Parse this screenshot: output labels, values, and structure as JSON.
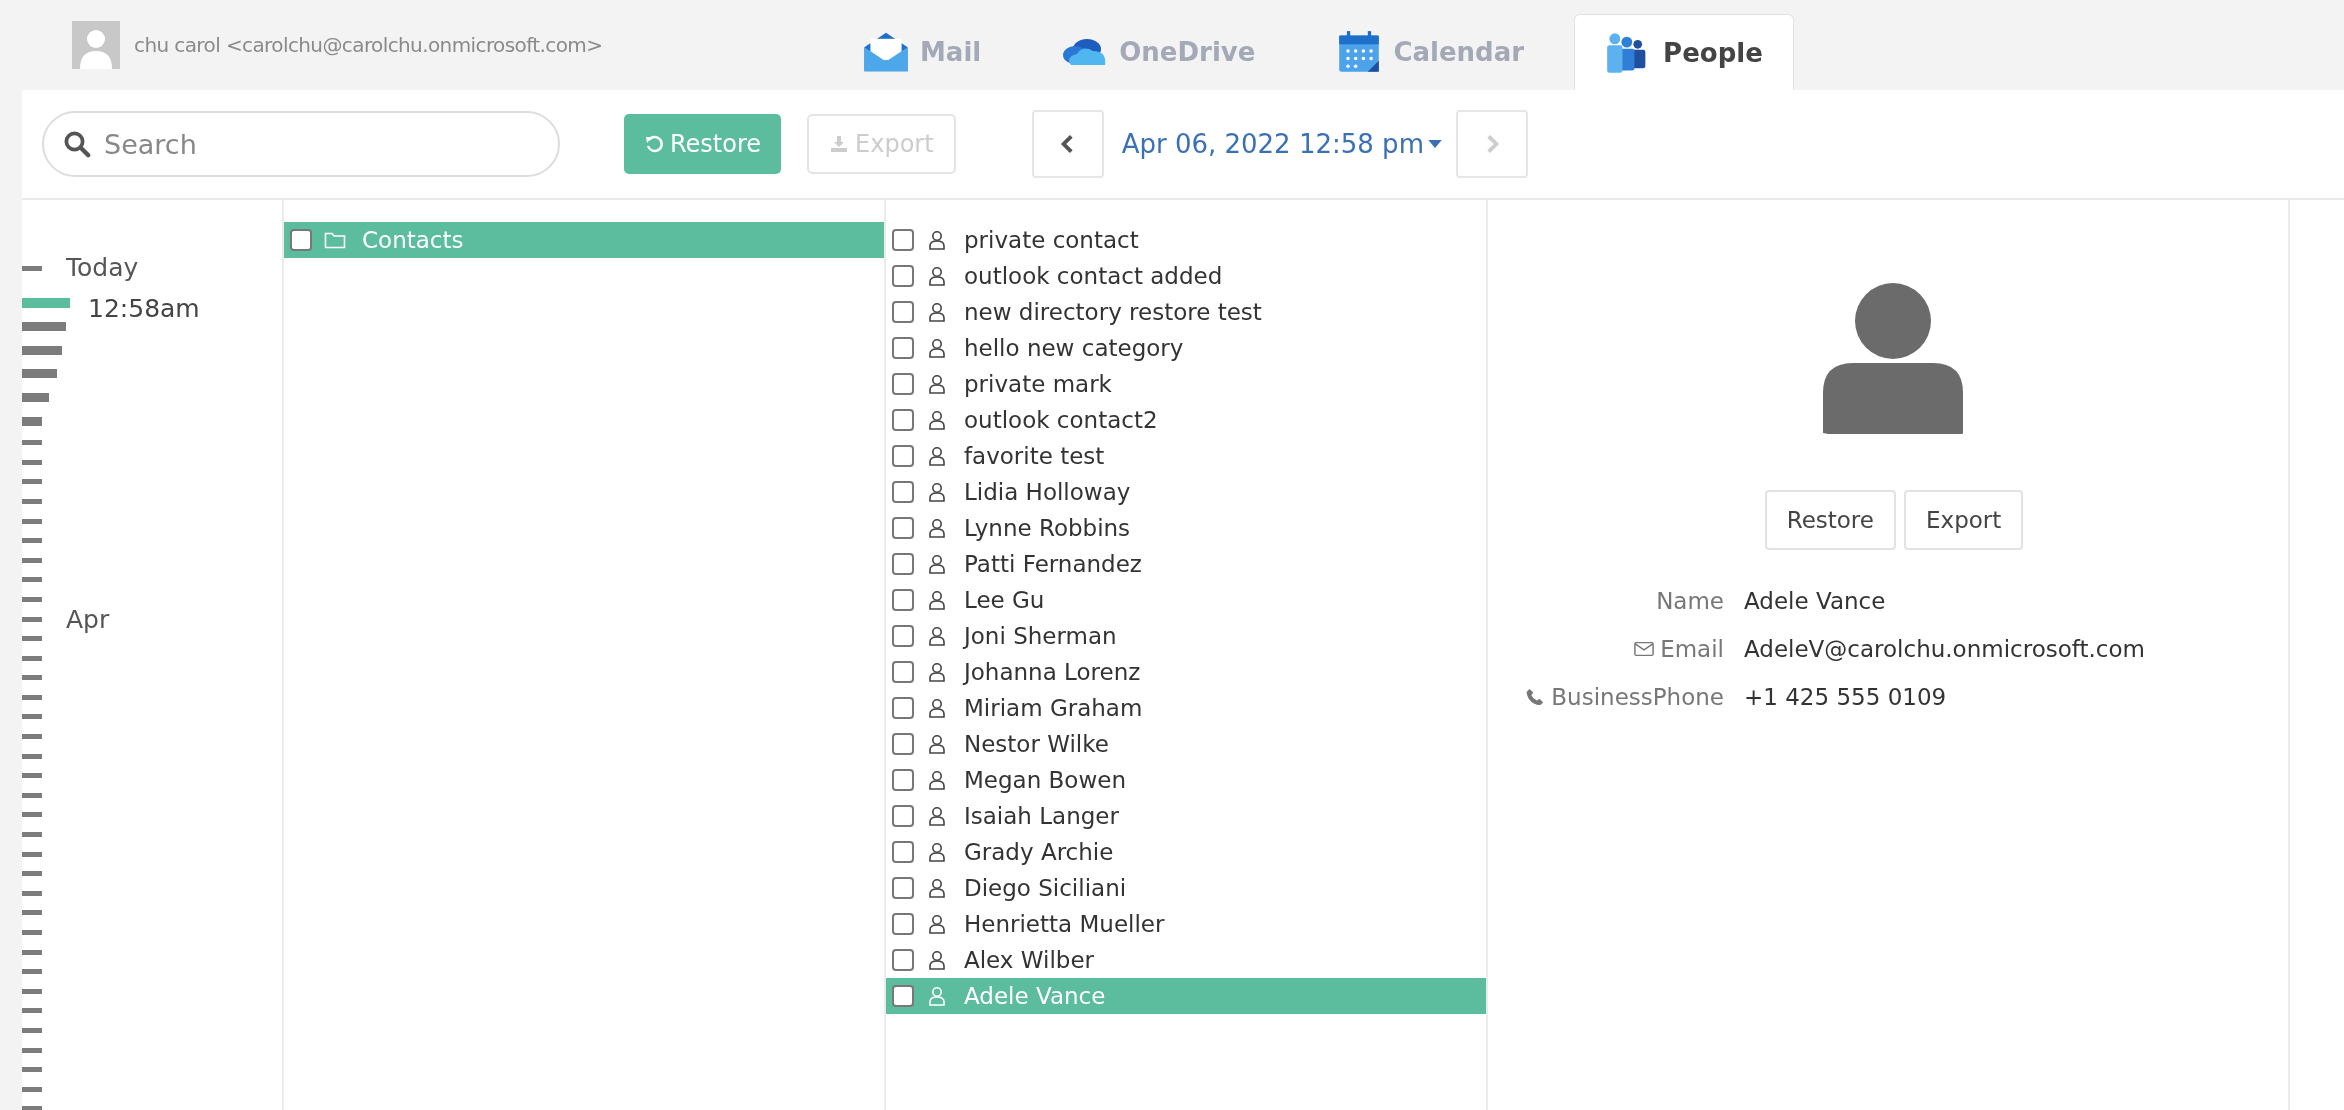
{
  "account": {
    "name": "chu carol <carolchu@carolchu.onmicrosoft.com>"
  },
  "tabs": [
    {
      "label": "Mail",
      "kind": "mail",
      "selected": false
    },
    {
      "label": "OneDrive",
      "kind": "onedrive",
      "selected": false
    },
    {
      "label": "Calendar",
      "kind": "calendar",
      "selected": false
    },
    {
      "label": "People",
      "kind": "people",
      "selected": true
    }
  ],
  "toolbar": {
    "search": {
      "placeholder": "Search"
    },
    "restore": {
      "label": "Restore",
      "disabled": false
    },
    "export": {
      "label": "Export",
      "disabled": true
    },
    "date": "Apr 06, 2022 12:58 pm",
    "prev_disabled": false,
    "next_disabled": true
  },
  "timeline": [
    {
      "label": "Today",
      "kind": "group",
      "selected": false
    },
    {
      "label": "12:58am",
      "kind": "time",
      "selected": true
    },
    {
      "label": "Apr",
      "kind": "group",
      "selected": false
    }
  ],
  "folders": [
    {
      "label": "Contacts",
      "checked": false,
      "selected": true
    }
  ],
  "contacts": [
    {
      "name": "private contact",
      "checked": false,
      "selected": false
    },
    {
      "name": "outlook contact added",
      "checked": false,
      "selected": false
    },
    {
      "name": "new directory restore test",
      "checked": false,
      "selected": false
    },
    {
      "name": "hello new category",
      "checked": false,
      "selected": false
    },
    {
      "name": "private mark",
      "checked": false,
      "selected": false
    },
    {
      "name": "outlook contact2",
      "checked": false,
      "selected": false
    },
    {
      "name": "favorite test",
      "checked": false,
      "selected": false
    },
    {
      "name": "Lidia Holloway",
      "checked": false,
      "selected": false
    },
    {
      "name": "Lynne Robbins",
      "checked": false,
      "selected": false
    },
    {
      "name": "Patti Fernandez",
      "checked": false,
      "selected": false
    },
    {
      "name": "Lee Gu",
      "checked": false,
      "selected": false
    },
    {
      "name": "Joni Sherman",
      "checked": false,
      "selected": false
    },
    {
      "name": "Johanna Lorenz",
      "checked": false,
      "selected": false
    },
    {
      "name": "Miriam Graham",
      "checked": false,
      "selected": false
    },
    {
      "name": "Nestor Wilke",
      "checked": false,
      "selected": false
    },
    {
      "name": "Megan Bowen",
      "checked": false,
      "selected": false
    },
    {
      "name": "Isaiah Langer",
      "checked": false,
      "selected": false
    },
    {
      "name": "Grady Archie",
      "checked": false,
      "selected": false
    },
    {
      "name": "Diego Siciliani",
      "checked": false,
      "selected": false
    },
    {
      "name": "Henrietta Mueller",
      "checked": false,
      "selected": false
    },
    {
      "name": "Alex Wilber",
      "checked": false,
      "selected": false
    },
    {
      "name": "Adele Vance",
      "checked": false,
      "selected": true
    }
  ],
  "detail": {
    "buttons": [
      "Restore",
      "Export"
    ],
    "fields": [
      {
        "label": "Name",
        "kind": "name",
        "value": "Adele Vance"
      },
      {
        "label": "Email",
        "kind": "email",
        "value": "AdeleV@carolchu.onmicrosoft.com"
      },
      {
        "label": "BusinessPhone",
        "kind": "phone",
        "value": "+1 425 555 0109"
      }
    ]
  }
}
